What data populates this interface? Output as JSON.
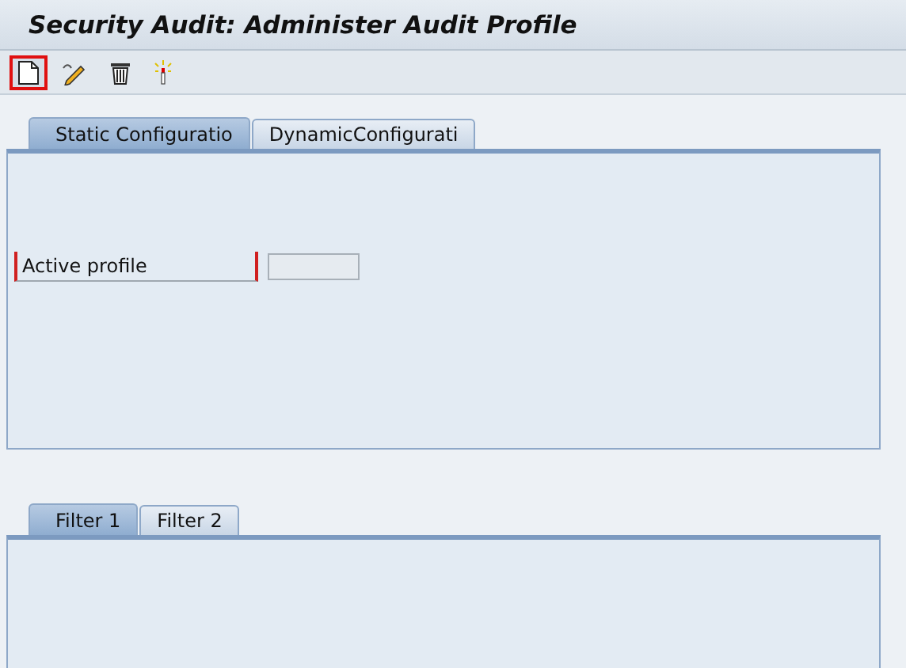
{
  "window": {
    "title": "Security Audit: Administer Audit Profile"
  },
  "toolbar": [
    {
      "kind": "new",
      "focused": true
    },
    {
      "kind": "edit",
      "focused": false
    },
    {
      "kind": "delete",
      "focused": false
    },
    {
      "kind": "activate",
      "focused": false
    }
  ],
  "config_tabs": [
    {
      "label": "Static Configuratio",
      "selected": true
    },
    {
      "label": "DynamicConfigurati",
      "selected": false
    }
  ],
  "active_profile": {
    "label": "Active profile"
  },
  "filter_tabs": [
    {
      "label": "Filter 1",
      "selected": true
    },
    {
      "label": "Filter 2",
      "selected": false
    }
  ]
}
